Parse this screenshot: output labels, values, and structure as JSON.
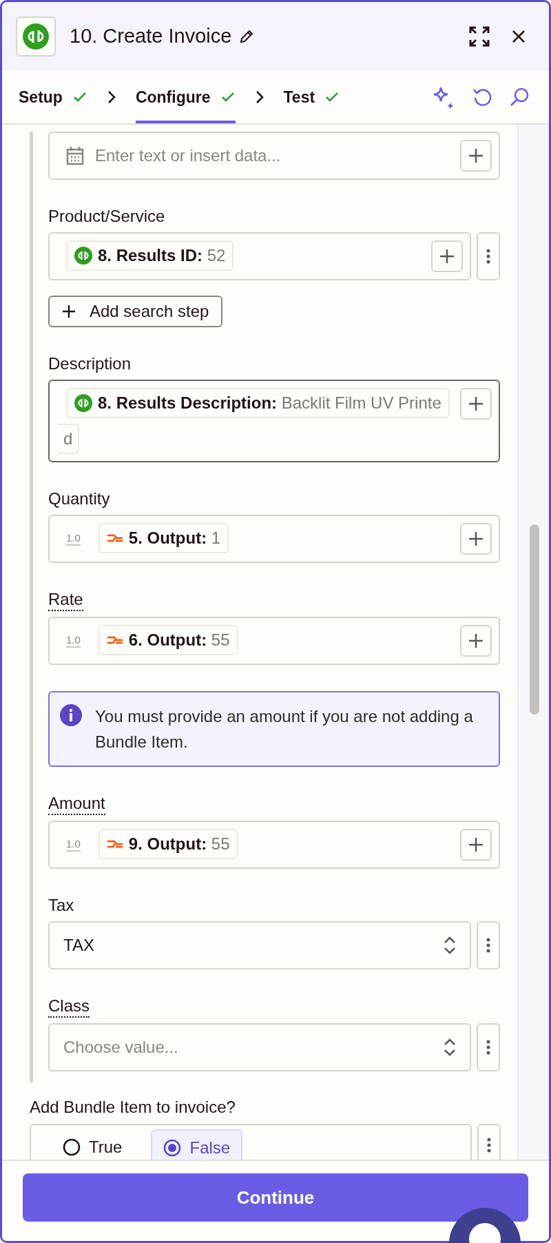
{
  "header": {
    "title": "10. Create Invoice",
    "tabs": [
      {
        "label": "Setup",
        "selected": false,
        "done": true
      },
      {
        "label": "Configure",
        "selected": true,
        "done": true
      },
      {
        "label": "Test",
        "selected": false,
        "done": true
      }
    ]
  },
  "fields": [
    {
      "kind": "text",
      "placeholder": "Enter text or insert data..."
    },
    {
      "kind": "mapped",
      "label": "Product/Service",
      "menu": true,
      "pills": [
        {
          "kind": "qb",
          "key": "8. Results ID:",
          "value": "52"
        }
      ],
      "search_step": "Add search step"
    },
    {
      "kind": "mapped",
      "label": "Description",
      "focused": true,
      "pills": [
        {
          "kind": "qb",
          "key": "8. Results Description:",
          "value": "Backlit Film UV Printe",
          "value_continued": "d"
        }
      ]
    },
    {
      "kind": "number",
      "label": "Quantity",
      "type_label": "1.0",
      "pills": [
        {
          "kind": "formatter",
          "key": "5. Output:",
          "value": "1"
        }
      ]
    },
    {
      "kind": "number",
      "label": "Rate",
      "help": true,
      "type_label": "1.0",
      "pills": [
        {
          "kind": "formatter",
          "key": "6. Output:",
          "value": "55"
        }
      ]
    },
    {
      "kind": "notice",
      "text": "You must provide an amount if you are not adding a Bundle Item."
    },
    {
      "kind": "number",
      "label": "Amount",
      "help": true,
      "type_label": "1.0",
      "pills": [
        {
          "kind": "formatter",
          "key": "9. Output:",
          "value": "55"
        }
      ]
    },
    {
      "kind": "select",
      "label": "Tax",
      "value": "TAX",
      "menu": true
    },
    {
      "kind": "select",
      "label": "Class",
      "help": true,
      "placeholder": "Choose value...",
      "menu": true
    }
  ],
  "bundle": {
    "label": "Add Bundle Item to invoice?",
    "options": [
      {
        "label": "True",
        "selected": false
      },
      {
        "label": "False",
        "selected": true
      }
    ]
  },
  "footer": {
    "button": "Continue"
  }
}
